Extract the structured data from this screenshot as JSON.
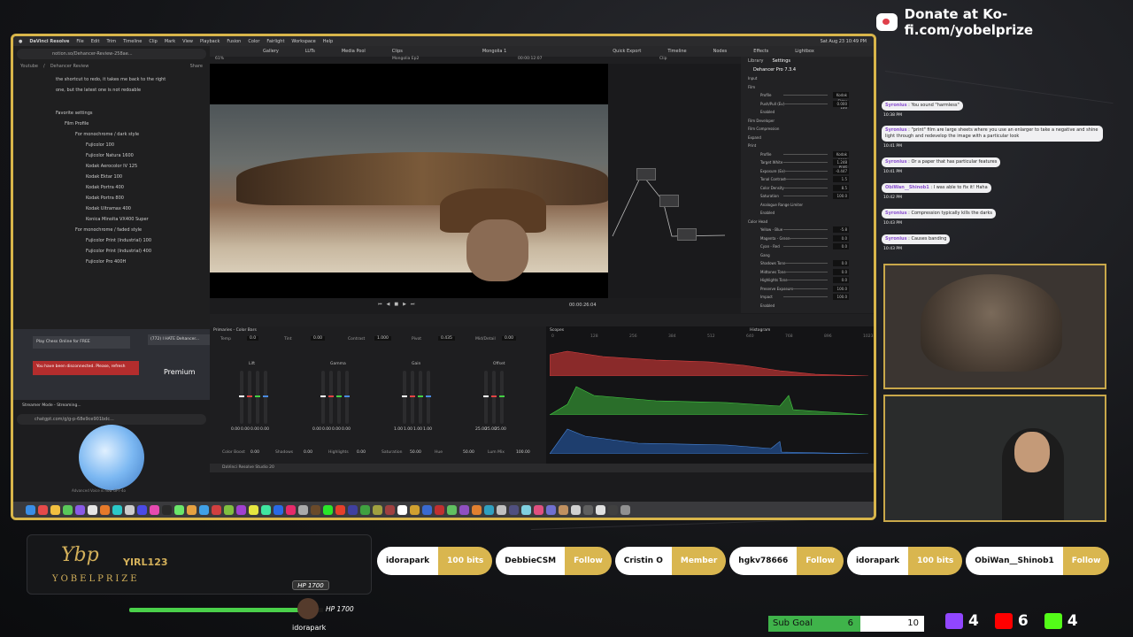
{
  "mac_menu": [
    "DaVinci Resolve",
    "File",
    "Edit",
    "Trim",
    "Timeline",
    "Clip",
    "Mark",
    "View",
    "Playback",
    "Fusion",
    "Color",
    "Fairlight",
    "Workspace",
    "Help"
  ],
  "mac_clock": "Sat Aug 23 10:49 PM",
  "notion": {
    "url": "notion.so/Dehancer-Review-258ae...",
    "breadcrumb": [
      "Youtube",
      "Dehancer Review"
    ],
    "share": "Share",
    "intro": "the shortcut to redo, it takes me back to the right one, but the latest one is not redoable",
    "heading": "Favorite settings",
    "film_profile": "Film Profile",
    "mono_dark": "For monochrome / dark style",
    "dark_items": [
      "Fujicolor 100",
      "Fujicolor Natura 1600",
      "Kodak Aerocolor IV 125",
      "Kodak Ektar 100",
      "Kodak Portra 400",
      "Kodak Portra 800",
      "Kodak Ultramax 400",
      "Konica Minolta VX400 Super"
    ],
    "mono_faded": "For monochrome / faded style",
    "faded_items": [
      "Fujicolor Print (Industrial) 100",
      "Fujicolor Print (Industrial) 400",
      "Fujicolor Pro 400H"
    ]
  },
  "chess": {
    "tab1": "Play Chess Online for FREE",
    "tab2": "(772) I HATE Dehancer...",
    "disconnected": "You have been disconnected. Please, refresh",
    "url": "chess.com/game",
    "yt": "Premium"
  },
  "chatgpt": {
    "tab": "Streamer Mode - Streaming...",
    "url": "chatgpt.com/g/g-p-68e9ce901bdc...",
    "hint": "Advanced Voice is now GPT-4o"
  },
  "resolve": {
    "project": "Mongolia 1",
    "timeline": "Mongolia Ep2",
    "timecode_top": "00:00:12:07",
    "timecode_bottom": "00:00:26:04",
    "zoom": "61%",
    "clip": "Clip",
    "tabs": [
      "Gallery",
      "LUTs",
      "Media Pool",
      "Clips"
    ],
    "right_tabs": [
      "Quick Export",
      "Timeline",
      "Nodes",
      "Effects",
      "Lightbox"
    ],
    "inspector_tabs": [
      "Library",
      "Settings"
    ],
    "plugin": "Dehancer Pro 7.3.4",
    "sections": [
      "Input",
      "Film",
      "Film Developer",
      "Film Compression",
      "Expand",
      "Print",
      "Color Head"
    ],
    "film_profile": "Kodak Ektar 100",
    "film_rows": [
      {
        "label": "Profile",
        "value": "Kodak Ektar 100"
      },
      {
        "label": "Push/Pull (Ev)",
        "value": "0.000"
      },
      {
        "label": "Enabled",
        "value": ""
      }
    ],
    "print_rows": [
      {
        "label": "Profile",
        "value": "Kodak 2383 Print Film"
      },
      {
        "label": "Target White",
        "value": "1.248"
      },
      {
        "label": "Exposure (Ev)",
        "value": "-0.447"
      },
      {
        "label": "Tonal Contrast",
        "value": "1.5"
      },
      {
        "label": "Color Density",
        "value": "8.5"
      },
      {
        "label": "Saturation",
        "value": "100.0"
      },
      {
        "label": "Analogue Range Limiter",
        "value": ""
      },
      {
        "label": "Enabled",
        "value": ""
      }
    ],
    "colorhead_rows": [
      {
        "label": "Yellow - Blue",
        "value": "-5.8"
      },
      {
        "label": "Magenta - Green",
        "value": "0.0"
      },
      {
        "label": "Cyan - Red",
        "value": "0.0"
      },
      {
        "label": "Gang",
        "value": ""
      },
      {
        "label": "Shadows Tone",
        "value": "0.0"
      },
      {
        "label": "Midtones Tone",
        "value": "0.0"
      },
      {
        "label": "Highlights Tone",
        "value": "0.0"
      },
      {
        "label": "Preserve Exposure",
        "value": "100.0"
      },
      {
        "label": "Impact",
        "value": "100.0"
      },
      {
        "label": "Enabled",
        "value": ""
      }
    ],
    "primaries_title": "Primaries - Color Bars",
    "primaries_top": [
      {
        "label": "Temp",
        "value": "0.0"
      },
      {
        "label": "Tint",
        "value": "0.00"
      },
      {
        "label": "Contrast",
        "value": "1.000"
      },
      {
        "label": "Pivot",
        "value": "0.435"
      },
      {
        "label": "Mid/Detail",
        "value": "0.00"
      }
    ],
    "wheels": [
      {
        "name": "Lift",
        "values": [
          "0.00",
          "0.00",
          "0.00",
          "0.00"
        ]
      },
      {
        "name": "Gamma",
        "values": [
          "0.00",
          "0.00",
          "0.00",
          "0.00"
        ]
      },
      {
        "name": "Gain",
        "values": [
          "1.00",
          "1.00",
          "1.00",
          "1.00"
        ]
      },
      {
        "name": "Offset",
        "values": [
          "25.00",
          "25.00",
          "25.00"
        ]
      }
    ],
    "primaries_bottom": [
      {
        "label": "Color Boost",
        "value": "0.00"
      },
      {
        "label": "Shadows",
        "value": "0.00"
      },
      {
        "label": "Highlights",
        "value": "0.00"
      },
      {
        "label": "Saturation",
        "value": "50.00"
      },
      {
        "label": "Hue",
        "value": "50.00"
      },
      {
        "label": "Lum Mix",
        "value": "100.00"
      }
    ],
    "scopes_title": "Scopes",
    "scopes_mode": "Histogram",
    "scope_ticks": [
      "0",
      "128",
      "256",
      "384",
      "512",
      "640",
      "768",
      "896",
      "1023"
    ],
    "app_footer": "DaVinci Resolve Studio 20"
  },
  "overlay": {
    "donate": "Donate at Ko-fi.com/yobelprize",
    "chat": [
      {
        "user": "Syronius",
        "text": "You sound \"harmless\"",
        "time": "10:38 PM"
      },
      {
        "user": "Syronius",
        "text": "\"print\" film are large sheets where you use an enlarger to take a negative and shine light through and redevelop the image with a particular look",
        "time": "10:41 PM"
      },
      {
        "user": "Syronius",
        "text": "Or a paper that has particular features",
        "time": "10:41 PM"
      },
      {
        "user": "ObiWan__Shinob1",
        "text": "I was able to fix it! Haha",
        "time": "10:42 PM"
      },
      {
        "user": "Syronius",
        "text": "Compression typically kills the darks",
        "time": "10:43 PM"
      },
      {
        "user": "Syronius",
        "text": "Causes banding",
        "time": "10:43 PM"
      }
    ],
    "brand": "YOBELPRIZE",
    "brand_script": "Ybp",
    "tag": "YIRL123",
    "alerts": [
      {
        "name": "idorapark",
        "action": "100 bits"
      },
      {
        "name": "DebbieCSM",
        "action": "Follow"
      },
      {
        "name": "Cristin O",
        "action": "Member"
      },
      {
        "name": "hgkv78666",
        "action": "Follow"
      },
      {
        "name": "idorapark",
        "action": "100 bits"
      },
      {
        "name": "ObiWan__Shinob1",
        "action": "Follow"
      }
    ],
    "hp_box": "HP 1700",
    "hp_label": "HP 1700",
    "hp_fraction": 0.88,
    "hp_user": "idorapark",
    "subgoal_label": "Sub Goal",
    "subgoal_current": "6",
    "subgoal_target": "10",
    "counts": [
      {
        "platform": "twitch-icon",
        "value": "4",
        "color": "#9146ff"
      },
      {
        "platform": "youtube-icon",
        "value": "6",
        "color": "#ff0000"
      },
      {
        "platform": "kick-icon",
        "value": "4",
        "color": "#53fc18"
      }
    ]
  }
}
